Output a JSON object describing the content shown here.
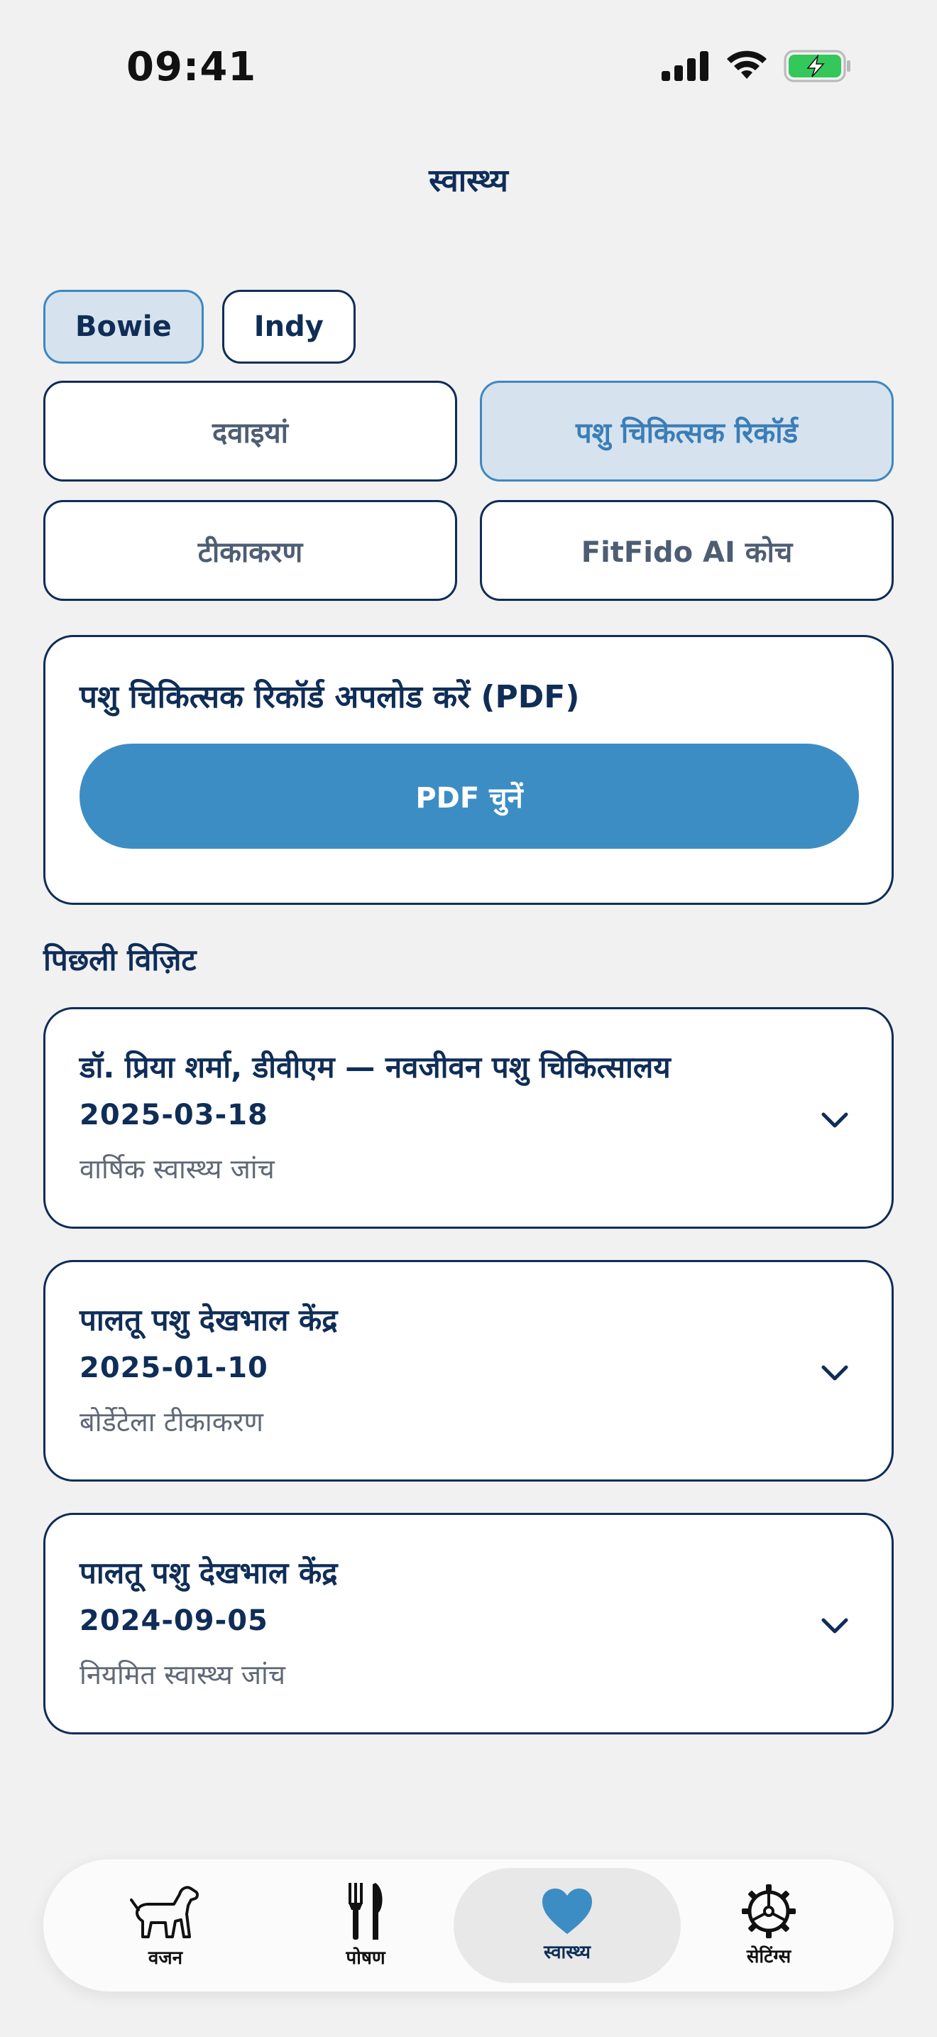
{
  "status": {
    "time": "09:41"
  },
  "page": {
    "title": "स्वास्थ्य"
  },
  "pets": [
    {
      "name": "Bowie",
      "selected": true
    },
    {
      "name": "Indy",
      "selected": false
    }
  ],
  "segments": [
    {
      "label": "दवाइयां",
      "selected": false
    },
    {
      "label": "पशु चिकित्सक रिकॉर्ड",
      "selected": true
    },
    {
      "label": "टीकाकरण",
      "selected": false
    },
    {
      "label": "FitFido AI कोच",
      "selected": false
    }
  ],
  "upload": {
    "title": "पशु चिकित्सक रिकॉर्ड अपलोड करें (PDF)",
    "button_label": "PDF चुनें"
  },
  "visits_section": {
    "title": "पिछली विज़िट",
    "items": [
      {
        "name": "डॉ. प्रिया शर्मा, डीवीएम — नवजीवन पशु चिकित्सालय",
        "date": "2025-03-18",
        "description": "वार्षिक स्वास्थ्य जांच"
      },
      {
        "name": "पालतू पशु देखभाल केंद्र",
        "date": "2025-01-10",
        "description": "बोर्डेटेला टीकाकरण"
      },
      {
        "name": "पालतू पशु देखभाल केंद्र",
        "date": "2024-09-05",
        "description": "नियमित स्वास्थ्य जांच"
      }
    ]
  },
  "tabbar": {
    "items": [
      {
        "label": "वजन",
        "icon": "dog-icon",
        "active": false
      },
      {
        "label": "पोषण",
        "icon": "fork-knife-icon",
        "active": false
      },
      {
        "label": "स्वास्थ्य",
        "icon": "heart-icon",
        "active": true
      },
      {
        "label": "सेटिंग्स",
        "icon": "gear-icon",
        "active": false
      }
    ]
  },
  "colors": {
    "primary": "#0f2d57",
    "accent": "#3d8dc5",
    "selected_bg": "#d6e3ee",
    "background": "#f1f1f2",
    "battery": "#34c759"
  }
}
